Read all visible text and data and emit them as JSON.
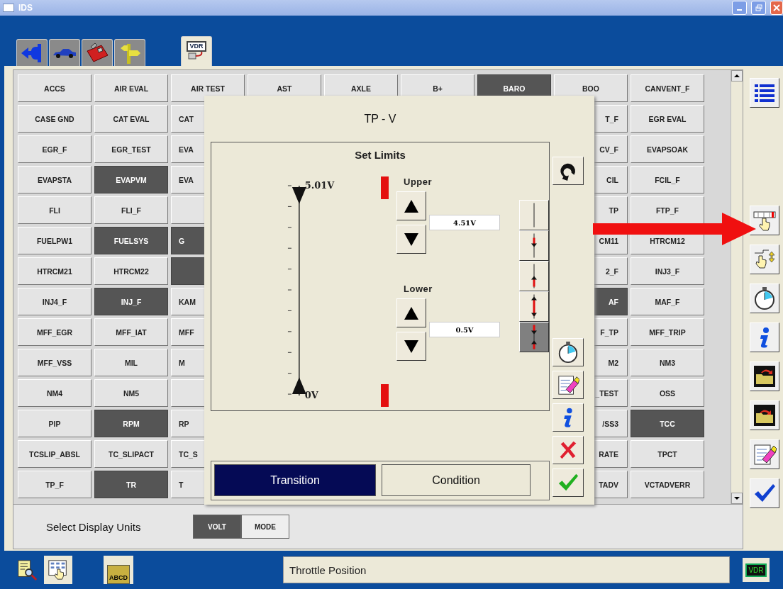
{
  "window": {
    "title": "IDS"
  },
  "top_tabs": [
    {
      "kind": "back",
      "selected": false
    },
    {
      "kind": "vehicle",
      "selected": false
    },
    {
      "kind": "toolbox",
      "selected": false
    },
    {
      "kind": "signpost",
      "selected": false
    },
    {
      "kind": "datalogger",
      "label": "VDR",
      "selected": true
    }
  ],
  "pid_grid": {
    "rows": [
      {
        "cells": [
          {
            "text": "ACCS",
            "selected": false
          },
          {
            "text": "AIR EVAL",
            "selected": false
          },
          {
            "text": "AIR TEST",
            "selected": false
          },
          {
            "text": "AST",
            "selected": false
          },
          {
            "text": "AXLE",
            "selected": false
          },
          {
            "text": "B+",
            "selected": false
          },
          {
            "text": "BARO",
            "selected": true
          },
          {
            "text": "BOO",
            "selected": false
          },
          {
            "text": "CANVENT_F",
            "selected": false
          }
        ]
      },
      {
        "left": [
          {
            "text": "CASE GND",
            "selected": false
          },
          {
            "text": "CAT EVAL",
            "selected": false
          },
          {
            "text": "CAT",
            "selected": false
          }
        ],
        "right": [
          {
            "text": "T_F",
            "selected": false
          },
          {
            "text": "EGR EVAL",
            "selected": false
          }
        ]
      },
      {
        "left": [
          {
            "text": "EGR_F",
            "selected": false
          },
          {
            "text": "EGR_TEST",
            "selected": false
          },
          {
            "text": "EVA",
            "selected": false
          }
        ],
        "right": [
          {
            "text": "CV_F",
            "selected": false
          },
          {
            "text": "EVAPSOAK",
            "selected": false
          }
        ]
      },
      {
        "left": [
          {
            "text": "EVAPSTA",
            "selected": false
          },
          {
            "text": "EVAPVM",
            "selected": true
          },
          {
            "text": "EVA",
            "selected": false
          }
        ],
        "right": [
          {
            "text": "CIL",
            "selected": false
          },
          {
            "text": "FCIL_F",
            "selected": false
          }
        ]
      },
      {
        "left": [
          {
            "text": "FLI",
            "selected": false
          },
          {
            "text": "FLI_F",
            "selected": false
          },
          {
            "selected": false
          }
        ],
        "right": [
          {
            "text": "TP",
            "selected": false
          },
          {
            "text": "FTP_F",
            "selected": false
          }
        ]
      },
      {
        "left": [
          {
            "text": "FUELPW1",
            "selected": false
          },
          {
            "text": "FUELSYS",
            "selected": true
          },
          {
            "text": "G",
            "selected": true
          }
        ],
        "right": [
          {
            "text": "CM11",
            "selected": false
          },
          {
            "text": "HTRCM12",
            "selected": false
          }
        ]
      },
      {
        "left": [
          {
            "text": "HTRCM21",
            "selected": false
          },
          {
            "text": "HTRCM22",
            "selected": false
          },
          {
            "selected": true
          }
        ],
        "right": [
          {
            "text": "2_F",
            "selected": false
          },
          {
            "text": "INJ3_F",
            "selected": false
          }
        ]
      },
      {
        "left": [
          {
            "text": "INJ4_F",
            "selected": false
          },
          {
            "text": "INJ_F",
            "selected": true
          },
          {
            "text": "KAM",
            "selected": false
          }
        ],
        "right": [
          {
            "text": "AF",
            "selected": true
          },
          {
            "text": "MAF_F",
            "selected": false
          }
        ]
      },
      {
        "left": [
          {
            "text": "MFF_EGR",
            "selected": false
          },
          {
            "text": "MFF_IAT",
            "selected": false
          },
          {
            "text": "MFF",
            "selected": false
          }
        ],
        "right": [
          {
            "text": "F_TP",
            "selected": false
          },
          {
            "text": "MFF_TRIP",
            "selected": false
          }
        ]
      },
      {
        "left": [
          {
            "text": "MFF_VSS",
            "selected": false
          },
          {
            "text": "MIL",
            "selected": false
          },
          {
            "text": "M",
            "selected": false
          }
        ],
        "right": [
          {
            "text": "M2",
            "selected": false
          },
          {
            "text": "NM3",
            "selected": false
          }
        ]
      },
      {
        "left": [
          {
            "text": "NM4",
            "selected": false
          },
          {
            "text": "NM5",
            "selected": false
          },
          {
            "selected": false
          }
        ],
        "right": [
          {
            "text": "_TEST",
            "selected": false
          },
          {
            "text": "OSS",
            "selected": false
          }
        ]
      },
      {
        "left": [
          {
            "text": "PIP",
            "selected": false
          },
          {
            "text": "RPM",
            "selected": true
          },
          {
            "text": "RP",
            "selected": false
          }
        ],
        "right": [
          {
            "text": "/SS3",
            "selected": false
          },
          {
            "text": "TCC",
            "selected": true
          }
        ]
      },
      {
        "left": [
          {
            "text": "TCSLIP_ABSL",
            "selected": false
          },
          {
            "text": "TC_SLIPACT",
            "selected": false
          },
          {
            "text": "TC_S",
            "selected": false
          }
        ],
        "right": [
          {
            "text": "RATE",
            "selected": false
          },
          {
            "text": "TPCT",
            "selected": false
          }
        ]
      },
      {
        "left": [
          {
            "text": "TP_F",
            "selected": false
          },
          {
            "text": "TR",
            "selected": true
          },
          {
            "text": "T",
            "selected": false
          }
        ],
        "right": [
          {
            "text": "TADV",
            "selected": false
          },
          {
            "text": "VCTADVERR",
            "selected": false
          }
        ]
      }
    ]
  },
  "units": {
    "label": "Select Display Units",
    "options": [
      {
        "label": "VOLT",
        "selected": true
      },
      {
        "label": "MODE",
        "selected": false
      }
    ]
  },
  "side_toolbar": [
    {
      "kind": "list"
    },
    {
      "kind": "slider"
    },
    {
      "kind": "hand-updown"
    },
    {
      "kind": "stopwatch"
    },
    {
      "kind": "info"
    },
    {
      "kind": "folder-open"
    },
    {
      "kind": "folder-save"
    },
    {
      "kind": "erase"
    },
    {
      "kind": "ok"
    }
  ],
  "dialog": {
    "title": "TP - V",
    "set_limits": {
      "title": "Set Limits",
      "scale_max": "5.01V",
      "scale_min": "0V",
      "upper": {
        "label": "Upper",
        "value": "4.51V"
      },
      "lower": {
        "label": "Lower",
        "value": "0.5V"
      },
      "modes": [
        {
          "kind": "none",
          "selected": false
        },
        {
          "kind": "below",
          "selected": false
        },
        {
          "kind": "above",
          "selected": false
        },
        {
          "kind": "outside",
          "selected": false
        },
        {
          "kind": "inside",
          "selected": true
        }
      ]
    },
    "trigger_tabs": [
      {
        "label": "Transition",
        "selected": true
      },
      {
        "label": "Condition",
        "selected": false
      }
    ],
    "buttons": [
      {
        "kind": "reset"
      },
      {
        "kind": "stopwatch"
      },
      {
        "kind": "erase"
      },
      {
        "kind": "info"
      },
      {
        "kind": "cancel"
      },
      {
        "kind": "ok"
      }
    ]
  },
  "status_bar": {
    "tabs": [
      {
        "kind": "document",
        "selected": false
      },
      {
        "kind": "grid",
        "selected": true
      }
    ],
    "binder": {
      "label": "ABCD"
    },
    "message": "Throttle Position",
    "device": {
      "label": "VDR"
    }
  }
}
